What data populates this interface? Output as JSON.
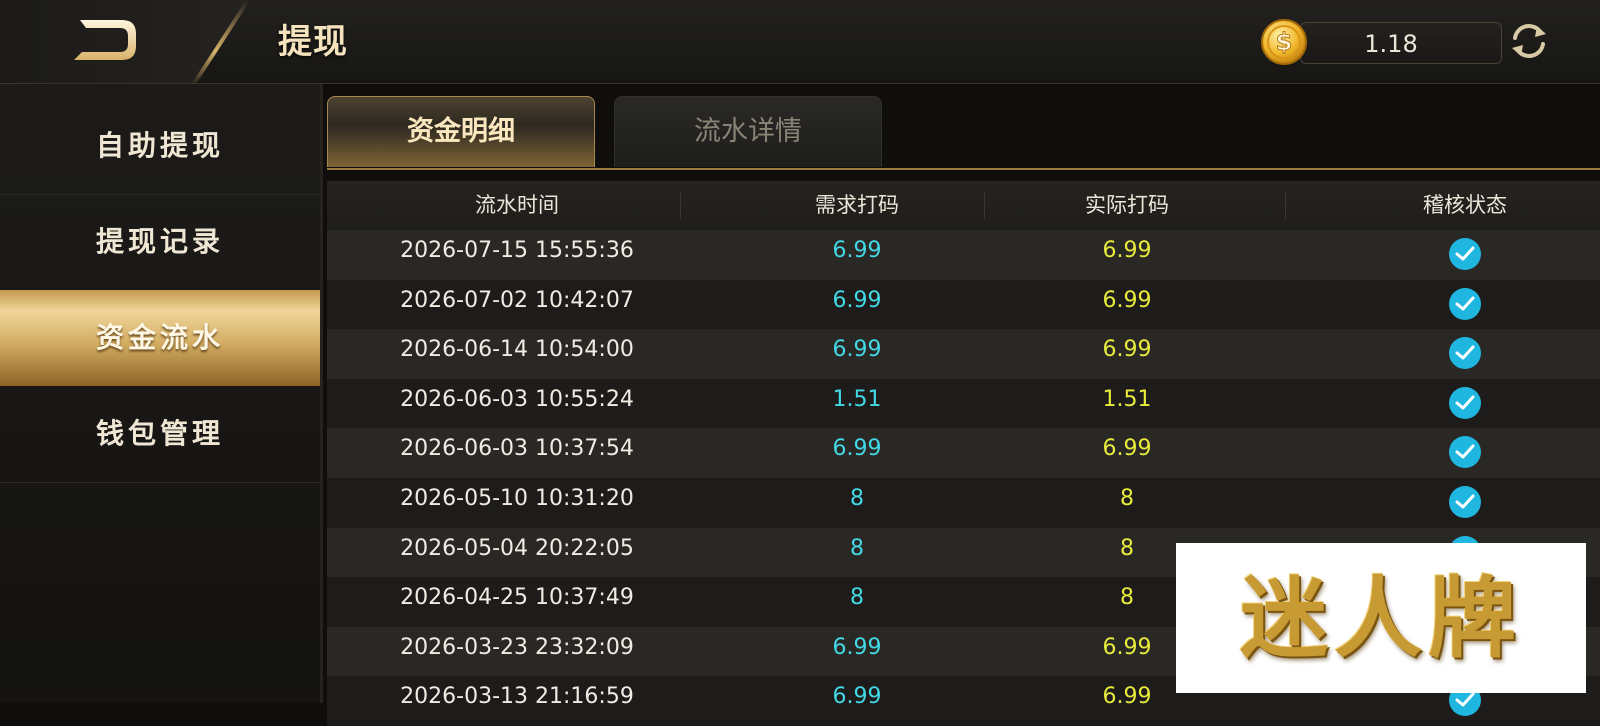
{
  "header": {
    "title": "提现",
    "balance": "1.18"
  },
  "sidebar": {
    "items": [
      {
        "label": "自助提现",
        "active": false
      },
      {
        "label": "提现记录",
        "active": false
      },
      {
        "label": "资金流水",
        "active": true
      },
      {
        "label": "钱包管理",
        "active": false
      }
    ]
  },
  "tabs": [
    {
      "label": "资金明细",
      "active": true
    },
    {
      "label": "流水详情",
      "active": false
    }
  ],
  "table": {
    "columns": [
      "流水时间",
      "需求打码",
      "实际打码",
      "稽核状态"
    ],
    "rows": [
      {
        "time": "2026-07-15 15:55:36",
        "required": "6.99",
        "actual": "6.99",
        "status": "checked"
      },
      {
        "time": "2026-07-02 10:42:07",
        "required": "6.99",
        "actual": "6.99",
        "status": "checked"
      },
      {
        "time": "2026-06-14 10:54:00",
        "required": "6.99",
        "actual": "6.99",
        "status": "checked"
      },
      {
        "time": "2026-06-03 10:55:24",
        "required": "1.51",
        "actual": "1.51",
        "status": "checked"
      },
      {
        "time": "2026-06-03 10:37:54",
        "required": "6.99",
        "actual": "6.99",
        "status": "checked"
      },
      {
        "time": "2026-05-10 10:31:20",
        "required": "8",
        "actual": "8",
        "status": "checked"
      },
      {
        "time": "2026-05-04 20:22:05",
        "required": "8",
        "actual": "8",
        "status": "checked"
      },
      {
        "time": "2026-04-25 10:37:49",
        "required": "8",
        "actual": "8",
        "status": "checked"
      },
      {
        "time": "2026-03-23 23:32:09",
        "required": "6.99",
        "actual": "6.99",
        "status": "checked"
      },
      {
        "time": "2026-03-13 21:16:59",
        "required": "6.99",
        "actual": "6.99",
        "status": "checked"
      }
    ]
  },
  "watermark": "迷人牌",
  "colors": {
    "gold_accent": "#d6b268",
    "required_color": "#42d8e6",
    "actual_color": "#e8ea3c",
    "check_color": "#1fb6e0"
  },
  "icons": [
    "back-icon",
    "coin-icon",
    "refresh-icon",
    "check-icon"
  ]
}
